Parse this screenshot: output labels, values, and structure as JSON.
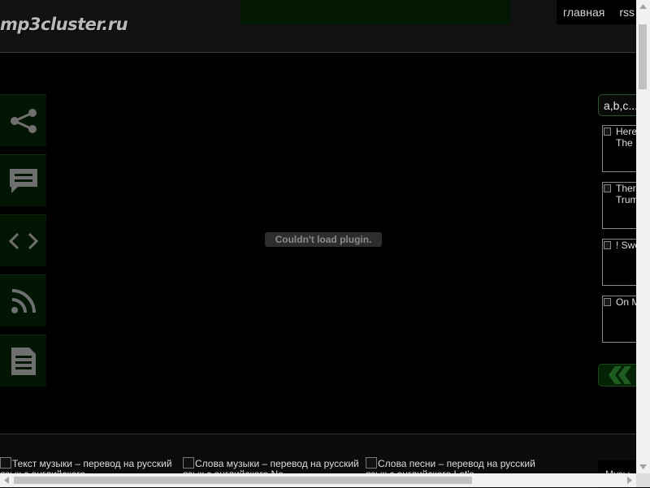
{
  "header": {
    "logo": "mp3cluster.ru",
    "nav": [
      "главная",
      "rss"
    ]
  },
  "sidebar": {
    "icons": [
      "share-icon",
      "comment-icon",
      "embed-icon",
      "rss-icon",
      "document-icon"
    ]
  },
  "main": {
    "plugin_message": "Couldn't load plugin."
  },
  "right": {
    "alphabet_button": "a,b,c...",
    "tracks": [
      {
        "title": "Here The"
      },
      {
        "title": "Ther Trum"
      },
      {
        "title": "! Swe"
      },
      {
        "title": "On M"
      }
    ],
    "prev_arrow_icon": "double-chevron-left-icon"
  },
  "bottom": {
    "items": [
      "Текст музыки – перевод на русский язык с английского",
      "Слова музыки – перевод на русский язык с английского No",
      "Слова песни – перевод на русский язык с английского Let's"
    ],
    "side_label": "Музы"
  },
  "colors": {
    "background": "#000000",
    "header_bg": "#111111",
    "panel_green": "#031603",
    "icon_gray": "#6f6f6f"
  }
}
